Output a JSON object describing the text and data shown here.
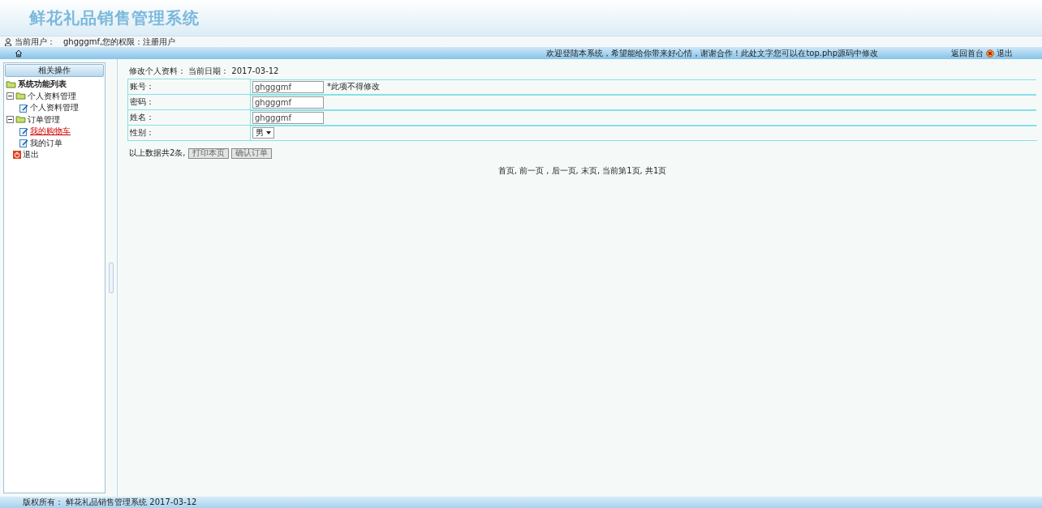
{
  "header": {
    "title": "鲜花礼品销售管理系统"
  },
  "user_bar": {
    "label": "当前用户：",
    "text": "ghgggmf,您的权限：注册用户"
  },
  "nav_bar": {
    "marquee": "欢迎登陆本系统，希望能给你带来好心情，谢谢合作！此处文字您可以在top.php源码中修改",
    "links": [
      {
        "kind": "back",
        "label": "返回首台"
      },
      {
        "kind": "logout",
        "label": "退出"
      }
    ]
  },
  "sidebar": {
    "title": "相关操作",
    "tree": [
      {
        "label": "系统功能列表",
        "expanded": true,
        "children": [
          {
            "kind": "folder",
            "label": "个人资料管理",
            "expanded": true,
            "children": [
              {
                "label": "个人资料管理",
                "selected": false
              }
            ]
          },
          {
            "kind": "folder",
            "label": "订单管理",
            "expanded": true,
            "children": [
              {
                "label": "我的购物车",
                "selected": true
              },
              {
                "label": "我的订单",
                "selected": false
              }
            ]
          },
          {
            "kind": "exit",
            "label": "退出",
            "selected": false
          }
        ]
      }
    ]
  },
  "content": {
    "heading": "修改个人资料：  当前日期：  2017-03-12",
    "rows": [
      {
        "kind": "input",
        "label": "账号：",
        "value": "ghgggmf",
        "note": "*此项不得修改"
      },
      {
        "kind": "input",
        "label": "密码：",
        "value": "ghgggmf"
      },
      {
        "kind": "input",
        "label": "姓名：",
        "value": "ghgggmf"
      },
      {
        "kind": "select",
        "label": "性别：",
        "value": "男"
      }
    ],
    "summary": "以上数据共2条,",
    "buttons": [
      "打印本页",
      "确认订单"
    ],
    "pager": "首页,  前一页  , 后一页,  末页,  当前第1页, 共1页"
  },
  "footer": {
    "text": "版权所有： 鲜花礼品销售管理系统 2017-03-12"
  }
}
